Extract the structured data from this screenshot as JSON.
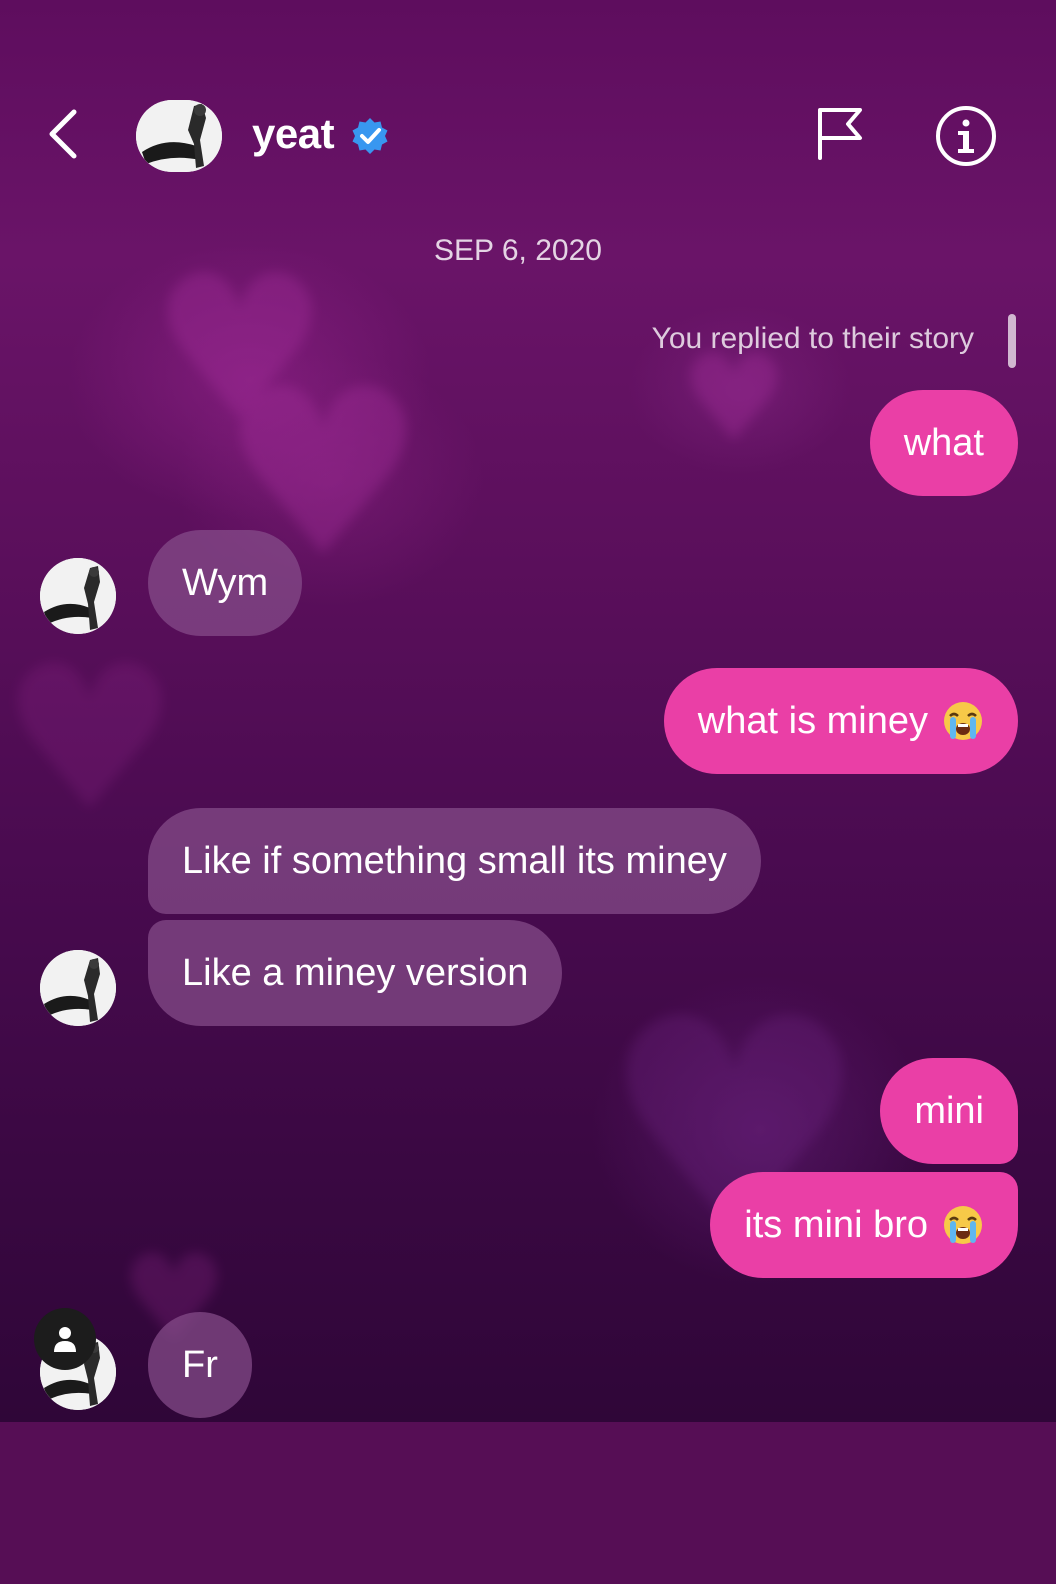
{
  "header": {
    "username": "yeat",
    "back_icon": "chevron-left-icon",
    "verified_icon": "verified-badge-icon",
    "flag_icon": "flag-icon",
    "info_icon": "info-icon"
  },
  "conversation": {
    "date": "SEP 6, 2020",
    "story_note": "You replied to their story",
    "messages": [
      {
        "from": "me",
        "text": "what"
      },
      {
        "from": "them",
        "text": "Wym"
      },
      {
        "from": "me",
        "text": "what is miney",
        "emoji": "loudly-crying-face"
      },
      {
        "from": "them",
        "text": "Like if something small its miney"
      },
      {
        "from": "them",
        "text": "Like a miney version"
      },
      {
        "from": "me",
        "text": "mini"
      },
      {
        "from": "me",
        "text": "its mini bro",
        "emoji": "loudly-crying-face"
      },
      {
        "from": "them",
        "text": "Fr"
      }
    ]
  },
  "colors": {
    "sent_bubble": "#ea3fa6",
    "received_bubble": "#864e8a",
    "background_top": "#6a1468",
    "background_bottom": "#2f0638",
    "bottom_fill": "#560e55",
    "verified": "#3897f0"
  }
}
